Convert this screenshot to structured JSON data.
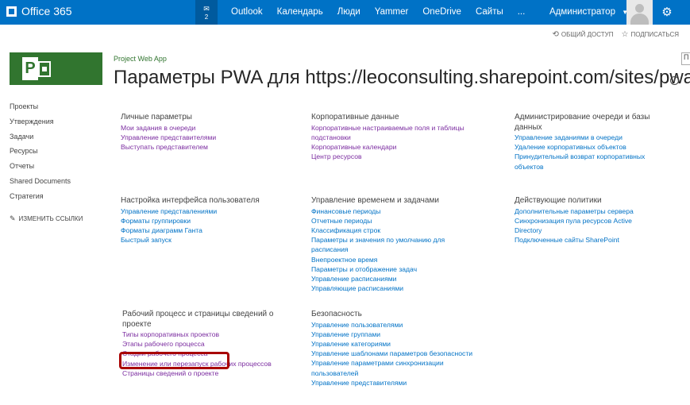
{
  "suite": {
    "brand": "Office 365",
    "notifications_count": "2",
    "nav": [
      "Outlook",
      "Календарь",
      "Люди",
      "Yammer",
      "OneDrive",
      "Сайты",
      "..."
    ],
    "user": "Администратор"
  },
  "actions": {
    "share": "ОБЩИЙ ДОСТУП",
    "follow": "ПОДПИСАТЬСЯ"
  },
  "search_stub": "П",
  "header": {
    "subtitle": "Project Web App",
    "title": "Параметры PWA для https://leoconsulting.sharepoint.com/sites/pwa"
  },
  "leftnav": {
    "items": [
      "Проекты",
      "Утверждения",
      "Задачи",
      "Ресурсы",
      "Отчеты",
      "Shared Documents",
      "Стратегия"
    ],
    "edit_links": "ИЗМЕНИТЬ ССЫЛКИ"
  },
  "sections": {
    "personal": {
      "title": "Личные параметры",
      "links": [
        "Мои задания в очереди",
        "Управление представителями",
        "Выступать представителем"
      ]
    },
    "enterprise": {
      "title": "Корпоративные данные",
      "links": [
        "Корпоративные настраиваемые поля и таблицы",
        "подстановки",
        "Корпоративные календари",
        "Центр ресурсов"
      ]
    },
    "queue": {
      "title_lines": [
        "Администрирование очереди и базы",
        "данных"
      ],
      "links": [
        "Управление заданиями в очереди",
        "Удаление корпоративных объектов",
        "Принудительный возврат корпоративных",
        "объектов"
      ]
    },
    "ui": {
      "title": "Настройка интерфейса пользователя",
      "links": [
        "Управление представлениями",
        "Форматы группировки",
        "Форматы диаграмм Ганта",
        "Быстрый запуск"
      ]
    },
    "time": {
      "title": "Управление временем и задачами",
      "links": [
        "Финансовые периоды",
        "Отчетные периоды",
        "Классификация строк",
        "Параметры и значения по умолчанию для",
        "расписания",
        "Внепроектное время",
        "Параметры и отображение задач",
        "Управление расписаниями",
        "Управляющие расписаниями"
      ]
    },
    "policies": {
      "title": "Действующие политики",
      "links": [
        "Дополнительные параметры сервера",
        "Синхронизация пула ресурсов Active",
        "Directory",
        "Подключенные сайты SharePoint"
      ]
    },
    "workflow": {
      "title_lines": [
        "Рабочий процесс и страницы сведений о",
        "проекте"
      ],
      "links": [
        "Типы корпоративных проектов",
        "Этапы рабочего процесса",
        "Стадии рабочего процесса",
        "Изменение или перезапуск рабочих процессов",
        "Страницы сведений о проекте"
      ]
    },
    "security": {
      "title": "Безопасность",
      "links": [
        "Управление пользователями",
        "Управление группами",
        "Управление категориями",
        "Управление шаблонами параметров безопасности",
        "Управление параметрами синхронизации",
        "пользователей",
        "Управление представителями"
      ]
    }
  },
  "colors": {
    "suite_bar": "#0072c6",
    "project_green": "#31752f",
    "link_purple": "#7b2ca0",
    "link_blue": "#0072c6",
    "highlight_red": "#a80000"
  }
}
